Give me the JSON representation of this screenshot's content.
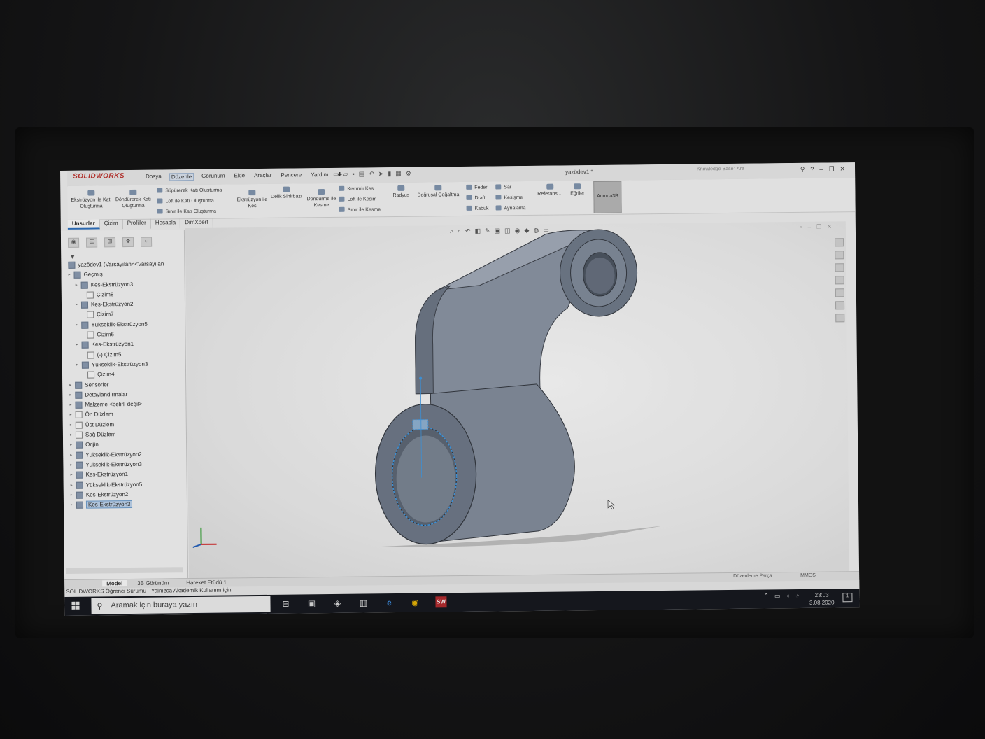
{
  "app": {
    "logo": "SOLIDWORKS",
    "document_title": "yazödev1 *",
    "search_placeholder": "Knowledge Base'i Ara",
    "menu": [
      "Dosya",
      "Düzenle",
      "Görünüm",
      "Ekle",
      "Araçlar",
      "Pencere",
      "Yardım"
    ]
  },
  "ribbon": {
    "extrude": "Ekstrüzyon ile Katı Oluşturma",
    "revolve": "Döndürerek Katı Oluşturma",
    "sweep": "Süpürerek Katı Oluşturma",
    "loft": "Loft ile Katı Oluşturma",
    "boundary": "Sınır ile Katı Oluşturma",
    "extruded_cut": "Ekstrüzyon ile Kes",
    "hole_wizard": "Delik Sihirbazı",
    "revolved_cut": "Döndürme ile Kesme",
    "swept_cut": "Kıvrımlı Kes",
    "lofted_cut": "Loft ile Kesim",
    "boundary_cut": "Sınır ile Kesme",
    "fillet": "Radyus",
    "linear_pattern": "Doğrusal Çoğaltma",
    "rib": "Feder",
    "draft": "Draft",
    "shell": "Kabuk",
    "wrap": "Sar",
    "intersect": "Kesişme",
    "mirror": "Aynalama",
    "reference": "Referans ...",
    "curves": "Eğriler",
    "instant3d": "Anında3B"
  },
  "command_tabs": [
    "Unsurlar",
    "Çizim",
    "Profiller",
    "Hesapla",
    "DimXpert"
  ],
  "feature_tree": [
    {
      "label": "yazödev1  (Varsayılan<<Varsayılan",
      "indent": 0,
      "type": "part"
    },
    {
      "label": "Geçmiş",
      "indent": 1,
      "type": "folder"
    },
    {
      "label": "Kes-Ekstrüzyon3",
      "indent": 2,
      "type": "feature"
    },
    {
      "label": "Çizim8",
      "indent": 3,
      "type": "sketch"
    },
    {
      "label": "Kes-Ekstrüzyon2",
      "indent": 2,
      "type": "feature"
    },
    {
      "label": "Çizim7",
      "indent": 3,
      "type": "sketch"
    },
    {
      "label": "Yükseklik-Ekstrüzyon5",
      "indent": 2,
      "type": "feature"
    },
    {
      "label": "Çizim6",
      "indent": 3,
      "type": "sketch"
    },
    {
      "label": "Kes-Ekstrüzyon1",
      "indent": 2,
      "type": "feature"
    },
    {
      "label": "(-) Çizim5",
      "indent": 3,
      "type": "sketch"
    },
    {
      "label": "Yükseklik-Ekstrüzyon3",
      "indent": 2,
      "type": "feature"
    },
    {
      "label": "Çizim4",
      "indent": 3,
      "type": "sketch"
    },
    {
      "label": "Sensörler",
      "indent": 1,
      "type": "folder"
    },
    {
      "label": "Detaylandırmalar",
      "indent": 1,
      "type": "folder"
    },
    {
      "label": "Malzeme <belirli değil>",
      "indent": 1,
      "type": "folder"
    },
    {
      "label": "Ön Düzlem",
      "indent": 1,
      "type": "plane"
    },
    {
      "label": "Üst Düzlem",
      "indent": 1,
      "type": "plane"
    },
    {
      "label": "Sağ Düzlem",
      "indent": 1,
      "type": "plane"
    },
    {
      "label": "Orijin",
      "indent": 1,
      "type": "origin"
    },
    {
      "label": "Yükseklik-Ekstrüzyon2",
      "indent": 1,
      "type": "feature"
    },
    {
      "label": "Yükseklik-Ekstrüzyon3",
      "indent": 1,
      "type": "feature"
    },
    {
      "label": "Kes-Ekstrüzyon1",
      "indent": 1,
      "type": "feature"
    },
    {
      "label": "Yükseklik-Ekstrüzyon5",
      "indent": 1,
      "type": "feature"
    },
    {
      "label": "Kes-Ekstrüzyon2",
      "indent": 1,
      "type": "feature"
    },
    {
      "label": "Kes-Ekstrüzyon3",
      "indent": 1,
      "type": "feature",
      "selected": true
    }
  ],
  "bottom_tabs": {
    "model": "Model",
    "view3d": "3B Görünüm",
    "motion": "Hareket Etüdü 1"
  },
  "status": {
    "mode": "Düzenleme Parça",
    "units": "MMGS",
    "license": "SOLIDWORKS Öğrenci Sürümü - Yalnızca Akademik Kullanım için"
  },
  "taskbar": {
    "search_placeholder": "Aramak için buraya yazın",
    "time": "23:03",
    "date": "3.08.2020"
  },
  "colors": {
    "part_face": "#7e8898",
    "part_dark": "#4c5563",
    "accent": "#2a6fbf",
    "sw_red": "#c0302b"
  }
}
